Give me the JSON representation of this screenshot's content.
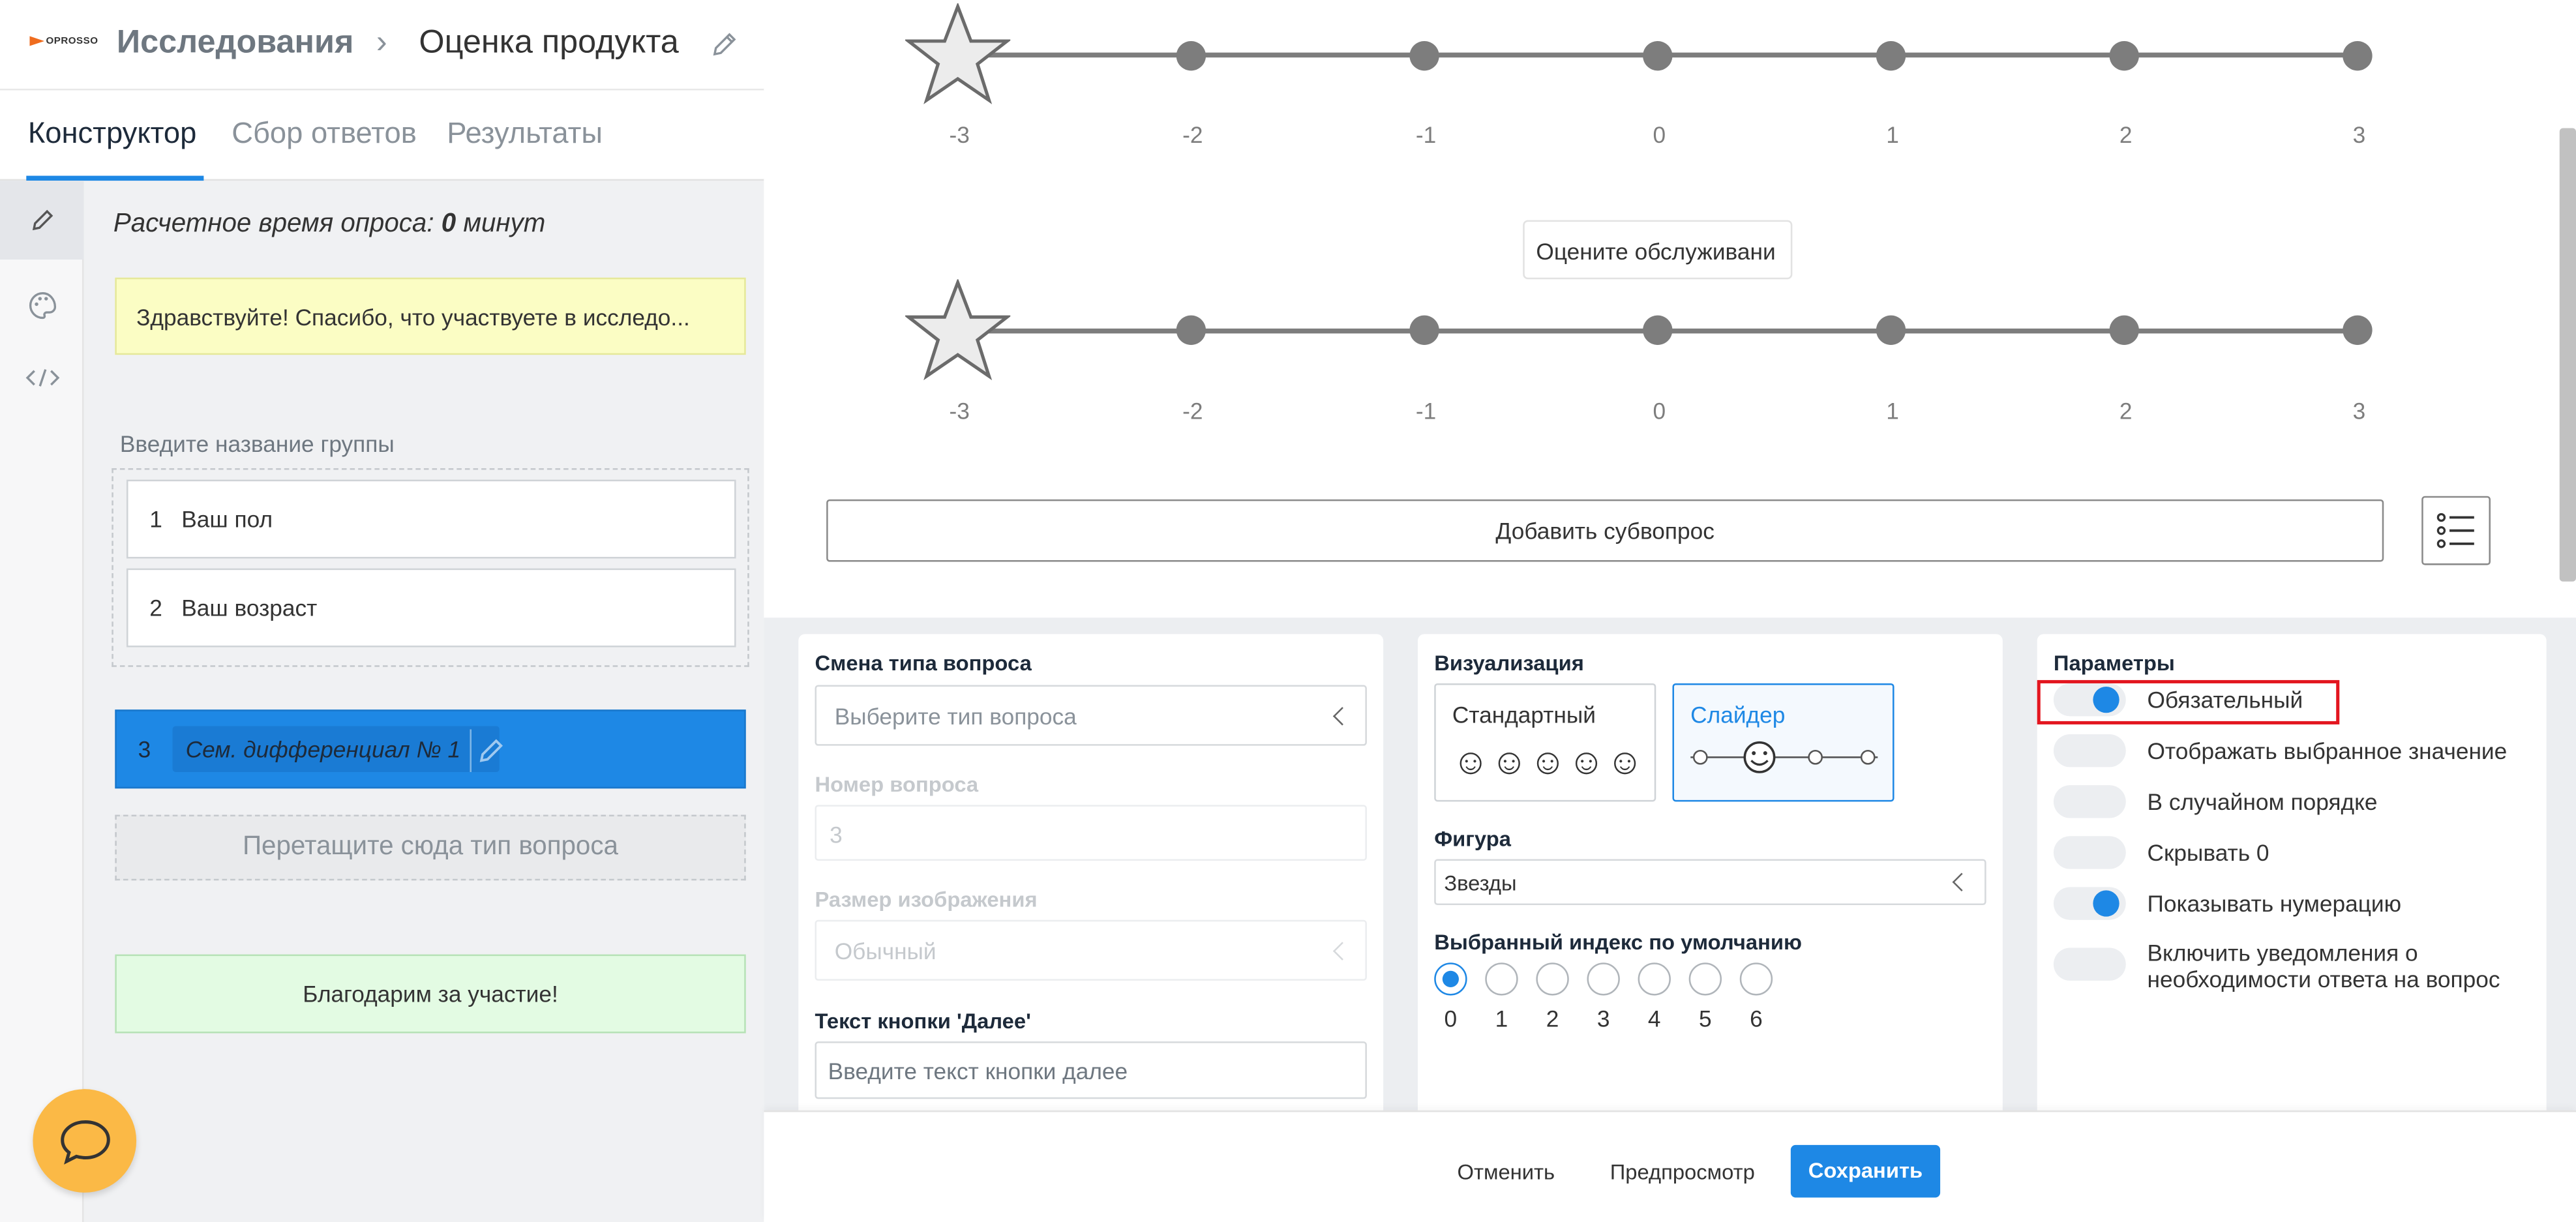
{
  "header": {
    "logo_text": "OPROSSO",
    "breadcrumb_root": "Исследования",
    "breadcrumb_sep": "›",
    "breadcrumb_current": "Оценка продукта"
  },
  "tabs": [
    {
      "label": "Конструктор",
      "active": true
    },
    {
      "label": "Сбор ответов",
      "active": false
    },
    {
      "label": "Результаты",
      "active": false
    }
  ],
  "rail": [
    "pencil-icon",
    "palette-icon",
    "code-icon"
  ],
  "estimate": {
    "prefix": "Расчетное время опроса: ",
    "value": "0",
    "suffix": " минут"
  },
  "welcome_text": "Здравствуйте! Спасибо, что участвуете в исследо...",
  "group": {
    "title_placeholder": "Введите название группы",
    "questions": [
      {
        "num": "1",
        "title": "Ваш пол"
      },
      {
        "num": "2",
        "title": "Ваш возраст"
      }
    ]
  },
  "current_question": {
    "num": "3",
    "title": "Сем. дифференциал № 1"
  },
  "drop_zone": "Перетащите сюда тип вопроса",
  "thanks_text": "Благодарим за участие!",
  "preview": {
    "scale_ticks": [
      "-3",
      "-2",
      "-1",
      "0",
      "1",
      "2",
      "3"
    ],
    "subquestion_label": "Оцените обслуживани",
    "add_subquestion": "Добавить субвопрос"
  },
  "type_card": {
    "title": "Смена типа вопроса",
    "type_placeholder": "Выберите тип вопроса",
    "number_label": "Номер вопроса",
    "number_value": "3",
    "image_size_label": "Размер изображения",
    "image_size_value": "Обычный",
    "next_label": "Текст кнопки 'Далее'",
    "next_placeholder": "Введите текст кнопки далее"
  },
  "vis_card": {
    "title": "Визуализация",
    "standard": "Стандартный",
    "standard_icons": "☺☺☺☺☺",
    "slider": "Слайдер",
    "figure_label": "Фигура",
    "figure_value": "Звезды",
    "default_index_label": "Выбранный индекс по умолчанию",
    "indices": [
      "0",
      "1",
      "2",
      "3",
      "4",
      "5",
      "6"
    ],
    "selected_index": 0
  },
  "params_card": {
    "title": "Параметры",
    "options": [
      {
        "label": "Обязательный",
        "on": true
      },
      {
        "label": "Отображать выбранное значение",
        "on": false
      },
      {
        "label": "В случайном порядке",
        "on": false
      },
      {
        "label": "Скрывать 0",
        "on": false
      },
      {
        "label": "Показывать нумерацию",
        "on": true
      },
      {
        "label": "Включить уведомления о необходимости ответа на вопрос",
        "on": false
      }
    ]
  },
  "footer": {
    "cancel": "Отменить",
    "preview": "Предпросмотр",
    "save": "Сохранить"
  },
  "colors": {
    "accent": "#1e88e5",
    "welcome_bg": "#fbfdc4",
    "thanks_bg": "#e3fbe3",
    "chat": "#fbb946",
    "highlight": "#e3161f"
  }
}
